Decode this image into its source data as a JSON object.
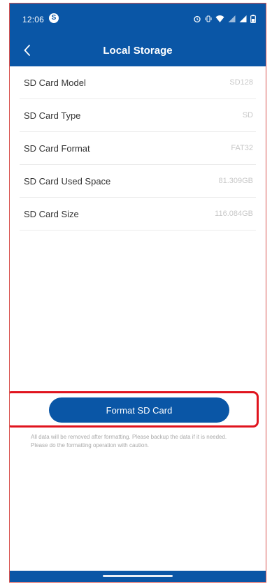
{
  "status_bar": {
    "time": "12:06",
    "app_icon_glyph": "S",
    "icons": [
      "alarm-icon",
      "vibrate-icon",
      "wifi-icon",
      "signal-icon",
      "signal-icon-2",
      "battery-icon"
    ]
  },
  "header": {
    "title": "Local Storage",
    "back_icon": "chevron-left-icon"
  },
  "storage_info": [
    {
      "label": "SD Card Model",
      "value": "SD128"
    },
    {
      "label": "SD Card Type",
      "value": "SD"
    },
    {
      "label": "SD Card Format",
      "value": "FAT32"
    },
    {
      "label": "SD Card Used Space",
      "value": "81.309GB"
    },
    {
      "label": "SD Card Size",
      "value": "116.084GB"
    }
  ],
  "format": {
    "button_label": "Format SD Card",
    "warning": "All data will be removed after formatting. Please backup the data if it is needed. Please do the formatting operation with caution."
  },
  "colors": {
    "primary": "#0a56a6",
    "highlight": "#e0141e",
    "value_text": "#c8c8c8"
  }
}
